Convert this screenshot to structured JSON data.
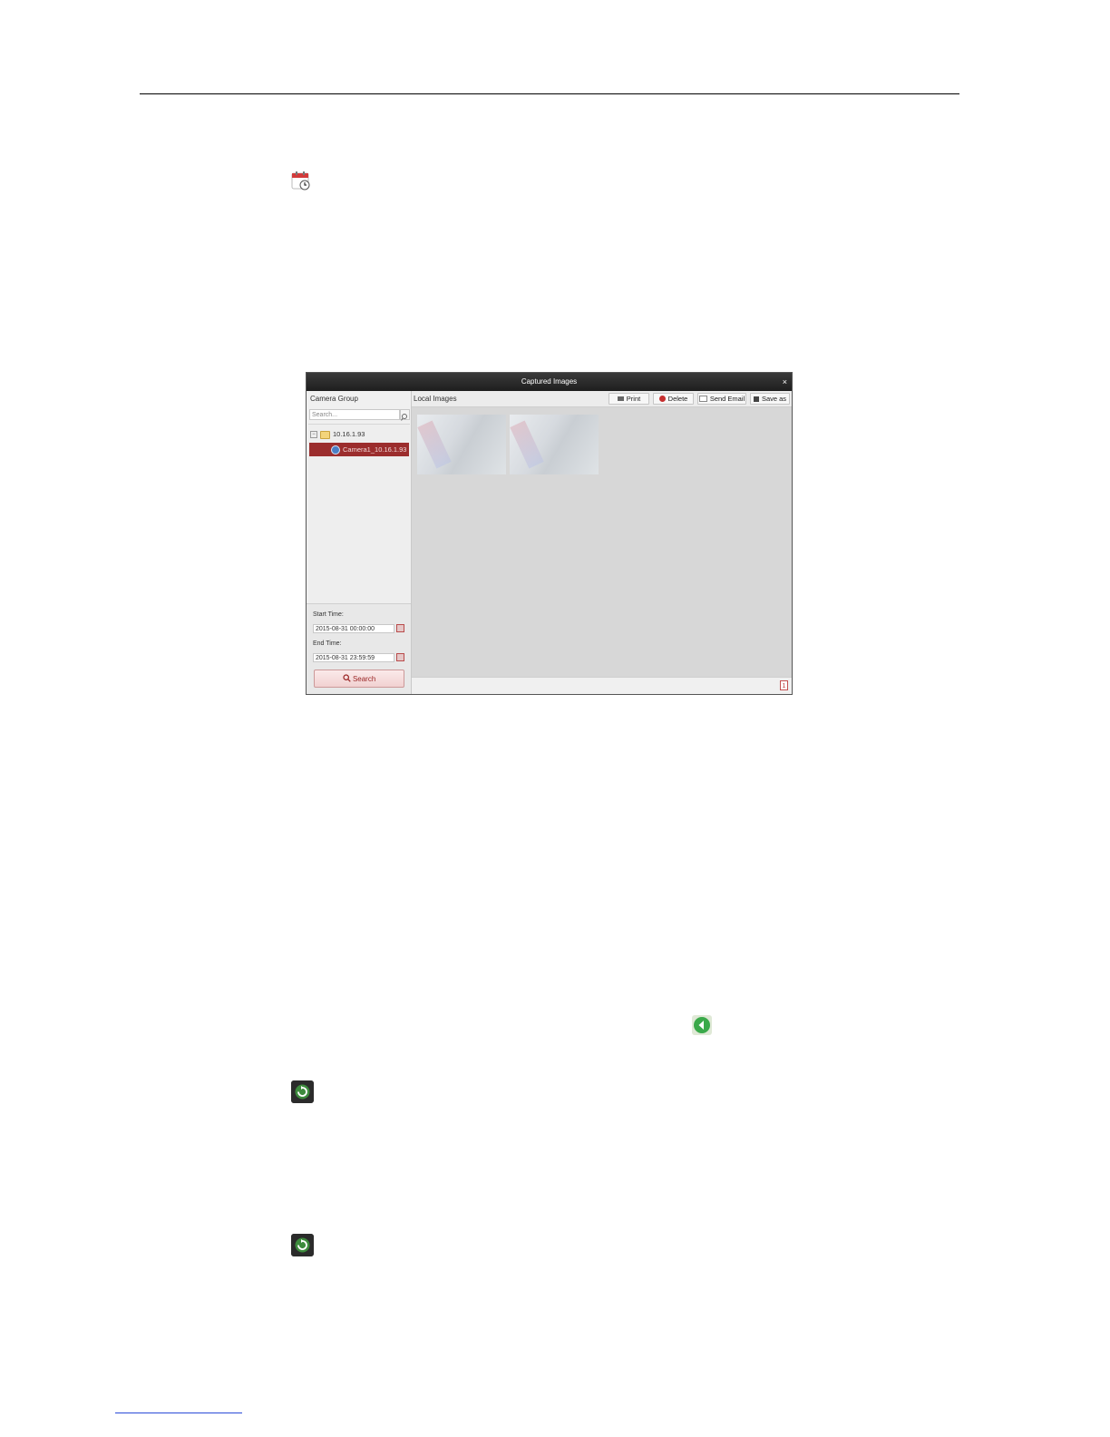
{
  "dialog": {
    "title": "Captured Images",
    "close_label": "×",
    "left": {
      "camera_group_title": "Camera Group",
      "search_placeholder": "Search...",
      "tree": {
        "group_label": "10.16.1.93",
        "group_expander": "−",
        "camera_label": "Camera1_10.16.1.93"
      },
      "start_time_label": "Start Time:",
      "start_time_value": "2015-08-31 00:00:00",
      "end_time_label": "End Time:",
      "end_time_value": "2015-08-31 23:59:59",
      "search_button": "Search"
    },
    "right": {
      "title": "Local Images",
      "toolbar": {
        "print": "Print",
        "delete": "Delete",
        "send_email": "Send Email",
        "save_as": "Save as"
      },
      "page_number": "1"
    }
  },
  "colors": {
    "title_bar": "#2a2a2a",
    "selected_row": "#9b2d2d",
    "accent_red": "#c62f2f"
  }
}
